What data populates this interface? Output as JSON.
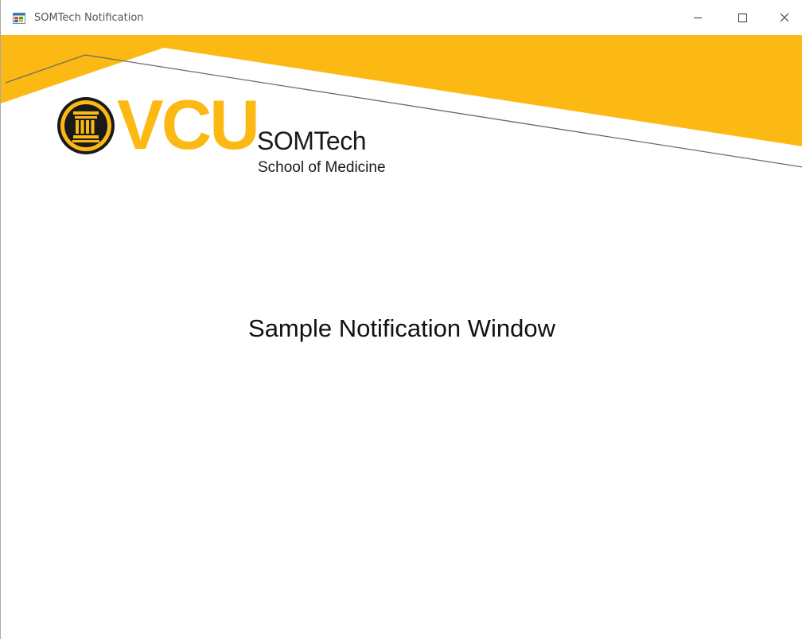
{
  "window": {
    "title": "SOMTech Notification",
    "app_icon": "windows-form-icon",
    "controls": {
      "minimize_icon": "minimize-icon",
      "maximize_icon": "maximize-icon",
      "close_icon": "close-icon"
    }
  },
  "branding": {
    "wordmark": "VCU",
    "department": "SOMTech",
    "school": "School of Medicine",
    "seal_icon": "vcu-seal-icon",
    "accent_color": "#fdb913",
    "line_color": "#6b6b6b"
  },
  "content": {
    "message": "Sample Notification Window"
  }
}
